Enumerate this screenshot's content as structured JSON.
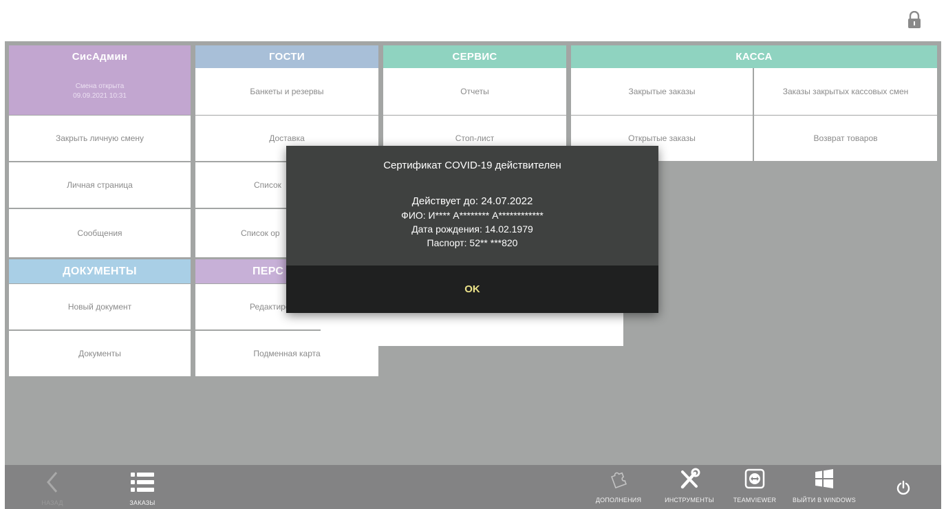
{
  "lock_icon": "lock-icon",
  "sections": {
    "sysadmin": {
      "header": "СисАдмин",
      "shift_status": "Смена открыта",
      "shift_datetime": "09.09.2021 10:31",
      "items": [
        "Закрыть личную смену",
        "Личная страница",
        "Сообщения"
      ]
    },
    "guests": {
      "header": "ГОСТИ",
      "items": [
        "Банкеты и резервы",
        "Доставка",
        "Список",
        "Список ор"
      ]
    },
    "service": {
      "header": "СЕРВИС",
      "items": [
        "Отчеты",
        "Стоп-лист"
      ]
    },
    "kassa": {
      "header": "КАССА",
      "items": [
        "Закрытые заказы",
        "Заказы закрытых кассовых смен",
        "Открытые заказы",
        "Возврат товаров"
      ]
    },
    "documents": {
      "header": "ДОКУМЕНТЫ",
      "items": [
        "Новый документ",
        "Документы"
      ]
    },
    "personnel": {
      "header": "ПЕРС",
      "items": [
        "Редактиро",
        "Подменная карта"
      ]
    }
  },
  "dialog": {
    "title": "Сертификат COVID-19 действителен",
    "valid_until": "Действует до: 24.07.2022",
    "fio": "ФИО: И**** А******** А************",
    "birth_date": "Дата рождения: 14.02.1979",
    "passport": "Паспорт: 52** ***820",
    "ok_label": "OK"
  },
  "bottom_bar": {
    "back": {
      "label": "НАЗАД",
      "icon": "chevron-left-icon"
    },
    "orders": {
      "label": "ЗАКАЗЫ",
      "icon": "list-icon"
    },
    "addons": {
      "label": "ДОПОЛНЕНИЯ",
      "icon": "puzzle-icon"
    },
    "tools": {
      "label": "ИНСТРУМЕНТЫ",
      "icon": "tools-icon"
    },
    "teamviewer": {
      "label": "TEAMVIEWER",
      "icon": "teamviewer-icon"
    },
    "exit_windows": {
      "label": "ВЫЙТИ В WINDOWS",
      "icon": "windows-icon"
    },
    "power": {
      "icon": "power-icon"
    }
  },
  "colors": {
    "sysadmin": "#c2a6d0",
    "guests": "#a8bfd8",
    "service": "#8fd3c0",
    "kassa": "#8fd3c0",
    "documents": "#a9cfe6",
    "personnel": "#c7b0d7",
    "ok_text": "#ece38a"
  }
}
